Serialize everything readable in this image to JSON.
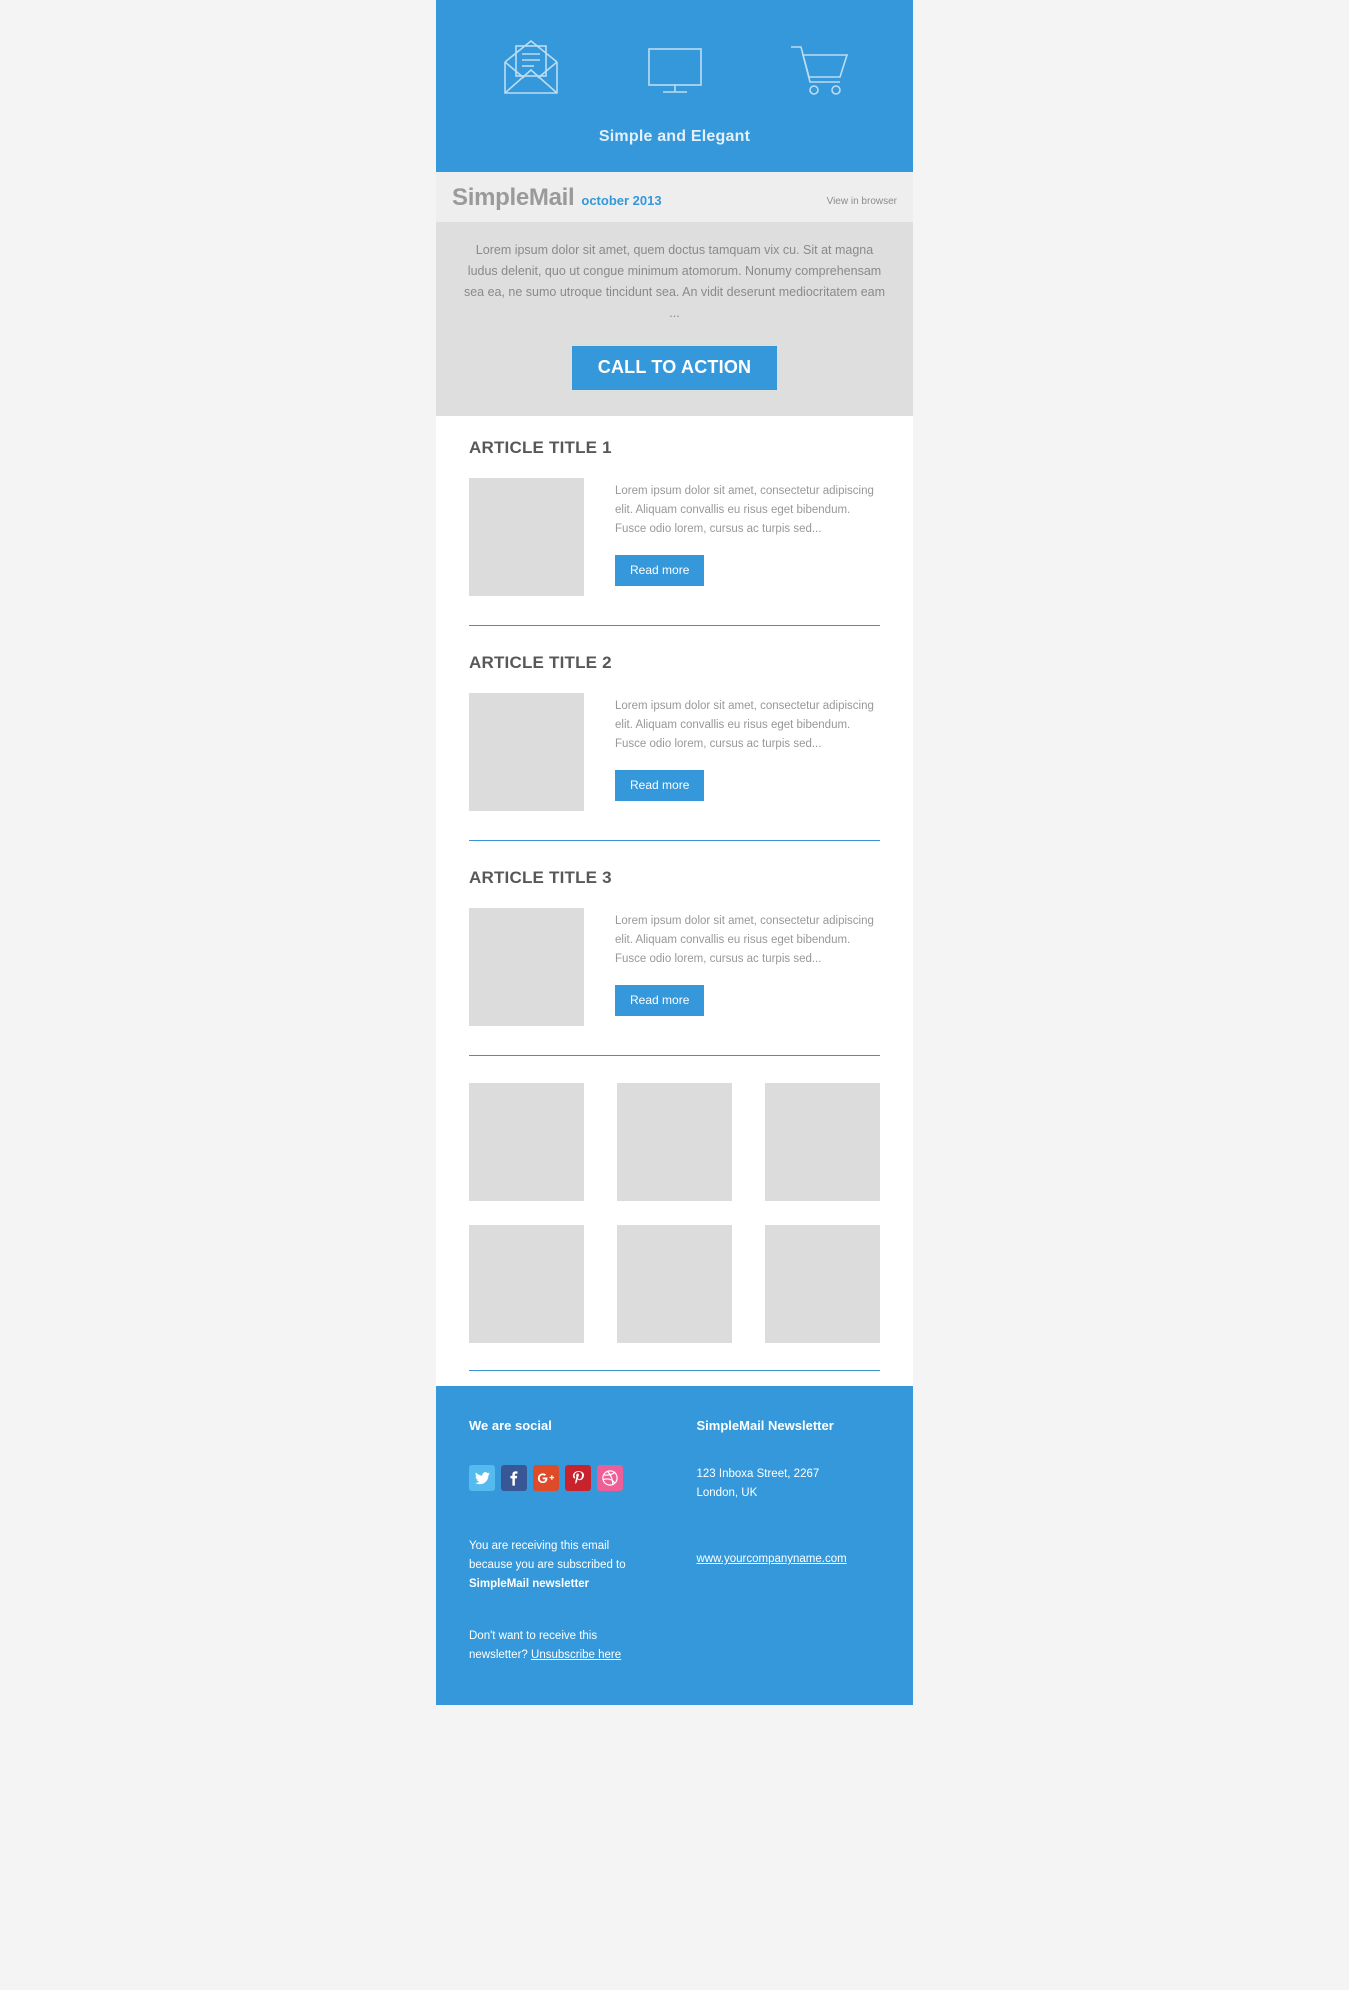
{
  "theme": {
    "accent": "#3498db",
    "page_bg": "#f4f4f4",
    "brandbar_bg": "#eeeeee",
    "intro_bg": "#dedede",
    "placeholder_gray": "#dcdcdc",
    "divider_blue": "#3a93d0",
    "body_text": "#989898",
    "title_text": "#585858"
  },
  "hero": {
    "icons": [
      "open-envelope-icon",
      "monitor-icon",
      "shopping-cart-icon"
    ],
    "title": "Simple and Elegant"
  },
  "brandbar": {
    "name": "SimpleMail",
    "date": "october 2013",
    "view_in_browser": "View in browser"
  },
  "intro": {
    "text": "Lorem ipsum dolor sit amet, quem doctus tamquam vix cu. Sit at magna ludus delenit, quo ut congue minimum atomorum. Nonumy comprehensam sea ea, ne sumo utroque tincidunt sea. An vidit deserunt mediocritatem eam ...",
    "cta_label": "CALL TO ACTION"
  },
  "articles": [
    {
      "title": "ARTICLE TITLE 1",
      "text": "Lorem ipsum dolor sit amet, consectetur adipiscing elit. Aliquam convallis eu risus eget bibendum. Fusce odio lorem, cursus ac turpis sed...",
      "button_label": "Read more",
      "thumb": "image-placeholder"
    },
    {
      "title": "ARTICLE TITLE 2",
      "text": "Lorem ipsum dolor sit amet, consectetur adipiscing elit. Aliquam convallis eu risus eget bibendum. Fusce odio lorem, cursus ac turpis sed...",
      "button_label": "Read more",
      "thumb": "image-placeholder"
    },
    {
      "title": "ARTICLE TITLE 3",
      "text": "Lorem ipsum dolor sit amet, consectetur adipiscing elit. Aliquam convallis eu risus eget bibendum. Fusce odio lorem, cursus ac turpis sed...",
      "button_label": "Read more",
      "thumb": "image-placeholder"
    }
  ],
  "gallery": {
    "rows": 2,
    "columns": 3,
    "cells": [
      "image-placeholder",
      "image-placeholder",
      "image-placeholder",
      "image-placeholder",
      "image-placeholder",
      "image-placeholder"
    ]
  },
  "footer": {
    "social_heading": "We are social",
    "social": [
      {
        "name": "twitter-icon",
        "color": "#55bbee"
      },
      {
        "name": "facebook-icon",
        "color": "#3a5795"
      },
      {
        "name": "googleplus-icon",
        "color": "#dd4b28"
      },
      {
        "name": "pinterest-icon",
        "color": "#c8232c"
      },
      {
        "name": "dribbble-icon",
        "color": "#ee5f98"
      }
    ],
    "subscribe_line1": "You are receiving this email",
    "subscribe_line2": "because you are subscribed to",
    "subscribe_line3": "SimpleMail newsletter",
    "unsub_line1": "Don't want to receive this",
    "unsub_prefix": "newsletter? ",
    "unsub_link": "Unsubscribe here",
    "newsletter_heading": "SimpleMail Newsletter",
    "address_line1": "123 Inboxa Street, 2267",
    "address_line2": "London, UK",
    "website": "www.yourcompanyname.com"
  }
}
